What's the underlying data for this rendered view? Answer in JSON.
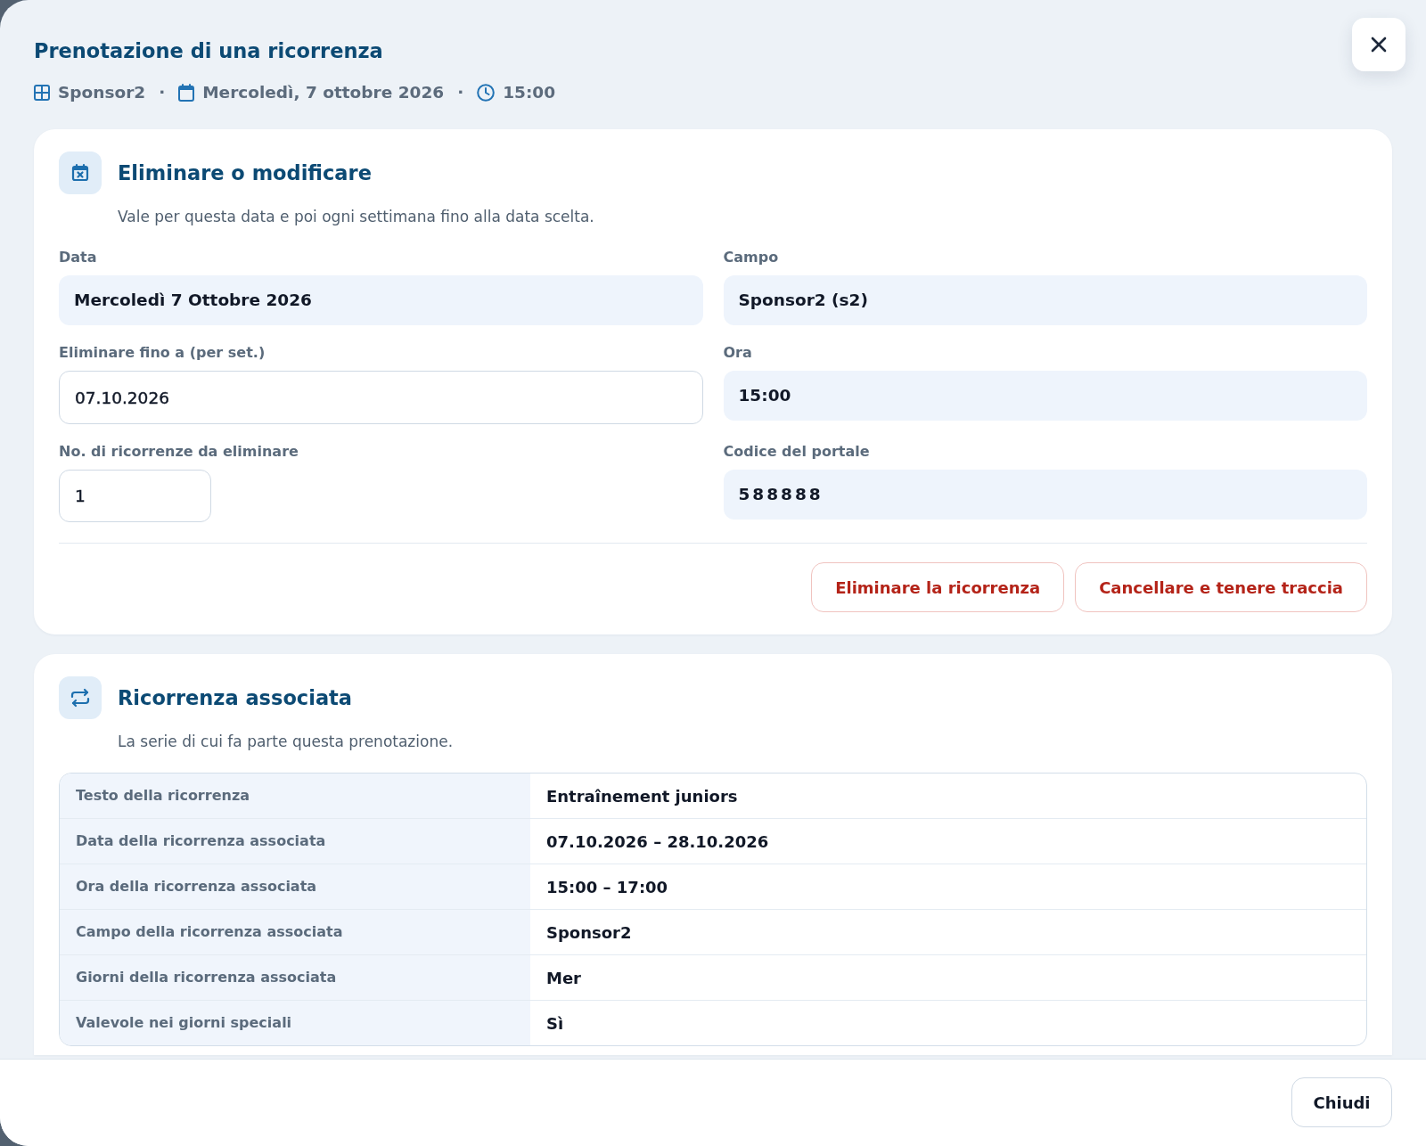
{
  "dialog": {
    "title": "Prenotazione di una ricorrenza",
    "meta": [
      {
        "kind": "court",
        "text": "Sponsor2"
      },
      {
        "kind": "separator",
        "text": "·"
      },
      {
        "kind": "date",
        "text": "Mercoledì, 7 ottobre 2026"
      },
      {
        "kind": "separator",
        "text": "·"
      },
      {
        "kind": "time",
        "text": "15:00"
      }
    ]
  },
  "sections": [
    {
      "kind": "form",
      "title": "Eliminare o modificare",
      "subtitle": "Vale per questa data e poi ogni settimana fino alla data scelta.",
      "fields": [
        {
          "kind": "static",
          "label": "Data",
          "value": "Mercoledì 7 Ottobre 2026"
        },
        {
          "kind": "static",
          "label": "Campo",
          "value": "Sponsor2 (s2)"
        },
        {
          "kind": "input",
          "label": "Eliminare fino a (per set.)",
          "value": "07.10.2026"
        },
        {
          "kind": "static",
          "label": "Ora",
          "value": "15:00"
        },
        {
          "kind": "number",
          "label": "No. di ricorrenze da eliminare",
          "value": "1"
        },
        {
          "kind": "code",
          "label": "Codice del portale",
          "value": "588888"
        }
      ],
      "actions": [
        "Eliminare la ricorrenza",
        "Cancellare e tenere traccia"
      ]
    },
    {
      "kind": "table",
      "title": "Ricorrenza associata",
      "subtitle": "La serie di cui fa parte questa prenotazione.",
      "rows": [
        {
          "label": "Testo della ricorrenza",
          "value": "Entraînement juniors"
        },
        {
          "label": "Data della ricorrenza associata",
          "value": "07.10.2026 – 28.10.2026"
        },
        {
          "label": "Ora della ricorrenza associata",
          "value": "15:00 – 17:00"
        },
        {
          "label": "Campo della ricorrenza associata",
          "value": "Sponsor2"
        },
        {
          "label": "Giorni della ricorrenza associata",
          "value": "Mer"
        },
        {
          "label": "Valevole nei giorni speciali",
          "value": "Sì"
        }
      ]
    }
  ],
  "footer": {
    "buttons": [
      "Chiudi"
    ]
  }
}
